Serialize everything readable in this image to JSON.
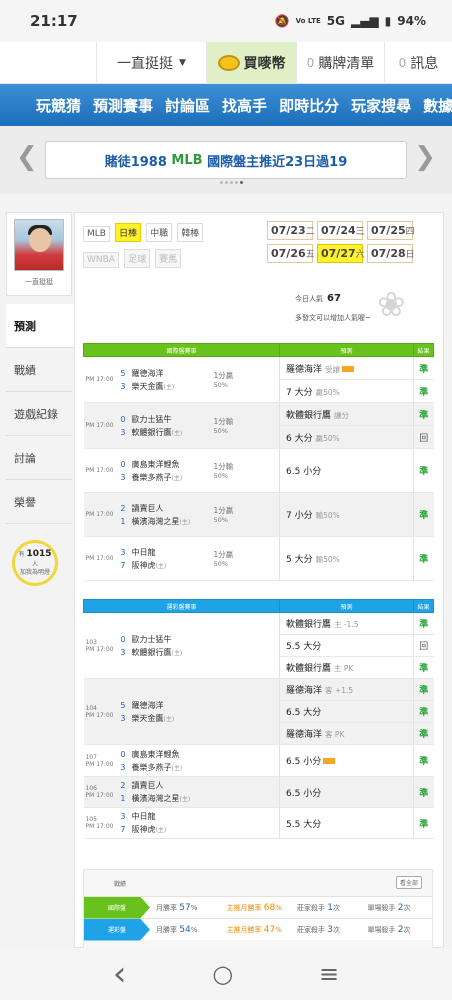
{
  "status": {
    "time": "21:17",
    "battery": "94%",
    "network": "5G",
    "volte": "VoLTE"
  },
  "topbar": {
    "dropdown": "一直挺挺",
    "coin": "買嘜幣",
    "cart": "購牌清單",
    "cart_count": "0",
    "msg": "訊息",
    "msg_count": "0"
  },
  "nav": [
    "玩競猜",
    "預測賽事",
    "討論區",
    "找高手",
    "即時比分",
    "玩家搜尋",
    "數據"
  ],
  "banner": {
    "user": "賭徒1988",
    "text": "國際盤主推近23日過19",
    "league": "MLB"
  },
  "profile": {
    "name": "一直挺挺"
  },
  "sidenav": [
    "預測",
    "戰績",
    "遊戲紀錄",
    "討論",
    "榮譽"
  ],
  "bulb": {
    "pre": "有",
    "count": "1015",
    "unit": "人",
    "post": "加我為明燈"
  },
  "leagues": [
    {
      "label": "MLB",
      "state": "normal"
    },
    {
      "label": "日棒",
      "state": "on"
    },
    {
      "label": "中職",
      "state": "normal"
    },
    {
      "label": "韓棒",
      "state": "normal"
    },
    {
      "label": "WNBA",
      "state": "dim"
    },
    {
      "label": "足球",
      "state": "dim"
    },
    {
      "label": "賽馬",
      "state": "dim"
    }
  ],
  "dates": [
    {
      "d": "07/23",
      "w": "二"
    },
    {
      "d": "07/24",
      "w": "三"
    },
    {
      "d": "07/25",
      "w": "四"
    },
    {
      "d": "07/26",
      "w": "五"
    },
    {
      "d": "07/27",
      "w": "六",
      "on": true
    },
    {
      "d": "07/28",
      "w": "日"
    }
  ],
  "today": {
    "label": "今日人氣",
    "value": "67"
  },
  "hint": "多發文可以增加人氣喔~",
  "intl": {
    "headers": [
      "國際盤賽事",
      "預測",
      "結果"
    ],
    "games": [
      {
        "time": "PM 17:00",
        "away_n": "5",
        "away": "羅德海洋",
        "home_n": "3",
        "home": "樂天金鷹",
        "home_tag": "(主)",
        "handicap": "1分贏",
        "hpct": "50%",
        "p1": "羅德海洋",
        "p1s": "受讓",
        "p1tag": true,
        "r1": "準",
        "p2": "7 大分",
        "p2s": "贏50%",
        "r2": "準"
      },
      {
        "time": "PM 17:00",
        "away_n": "0",
        "away": "歐力士猛牛",
        "home_n": "3",
        "home": "軟體銀行鷹",
        "home_tag": "(主)",
        "handicap": "1分輸",
        "hpct": "50%",
        "p1": "軟體銀行鷹",
        "p1s": "讓分",
        "r1": "準",
        "p2": "6 大分",
        "p2s": "贏50%",
        "r2": "回"
      },
      {
        "time": "PM 17:00",
        "away_n": "0",
        "away": "廣島東洋鯉魚",
        "home_n": "3",
        "home": "養樂多燕子",
        "home_tag": "(主)",
        "handicap": "1分輸",
        "hpct": "50%",
        "p1": "6.5 小分",
        "p1s": "",
        "r1": "準"
      },
      {
        "time": "PM 17:00",
        "away_n": "2",
        "away": "讀賣巨人",
        "home_n": "1",
        "home": "橫濱海灣之星",
        "home_tag": "(主)",
        "handicap": "1分贏",
        "hpct": "50%",
        "p1": "7 小分",
        "p1s": "輸50%",
        "r1": "準"
      },
      {
        "time": "PM 17:00",
        "away_n": "3",
        "away": "中日龍",
        "home_n": "7",
        "home": "阪神虎",
        "home_tag": "(主)",
        "handicap": "1分贏",
        "hpct": "50%",
        "p1": "5 大分",
        "p1s": "輸50%",
        "r1": "準"
      }
    ]
  },
  "lottery": {
    "headers": [
      "運彩盤賽事",
      "預測",
      "結果"
    ],
    "games": [
      {
        "no": "103",
        "time": "PM 17:00",
        "away_n": "0",
        "away": "歐力士猛牛",
        "home_n": "3",
        "home": "軟體銀行鷹",
        "home_tag": "(主)",
        "preds": [
          {
            "p": "軟體銀行鷹",
            "s": "主 -1.5",
            "r": "準"
          },
          {
            "p": "5.5 大分",
            "s": "",
            "r": "回"
          },
          {
            "p": "軟體銀行鷹",
            "s": "主 PK",
            "r": "準"
          }
        ]
      },
      {
        "no": "104",
        "time": "PM 17:00",
        "away_n": "5",
        "away": "羅德海洋",
        "home_n": "3",
        "home": "樂天金鷹",
        "home_tag": "(主)",
        "preds": [
          {
            "p": "羅德海洋",
            "s": "客 +1.5",
            "r": "準"
          },
          {
            "p": "6.5 大分",
            "s": "",
            "r": "準"
          },
          {
            "p": "羅德海洋",
            "s": "客 PK",
            "r": "準"
          }
        ]
      },
      {
        "no": "107",
        "time": "PM 17:00",
        "away_n": "0",
        "away": "廣島東洋鯉魚",
        "home_n": "3",
        "home": "養樂多燕子",
        "home_tag": "(主)",
        "preds": [
          {
            "p": "6.5 小分",
            "s": "",
            "tag": true,
            "r": "準"
          }
        ]
      },
      {
        "no": "106",
        "time": "PM 17:00",
        "away_n": "2",
        "away": "讀賣巨人",
        "home_n": "1",
        "home": "橫濱海灣之星",
        "home_tag": "(主)",
        "preds": [
          {
            "p": "6.5 小分",
            "s": "",
            "r": "準"
          }
        ]
      },
      {
        "no": "105",
        "time": "PM 17:00",
        "away_n": "3",
        "away": "中日龍",
        "home_n": "7",
        "home": "阪神虎",
        "home_tag": "(主)",
        "preds": [
          {
            "p": "5.5 大分",
            "s": "",
            "r": "準"
          }
        ]
      }
    ]
  },
  "stats": {
    "title": "戰績",
    "all": "看全部",
    "rows": [
      {
        "label": "國際盤",
        "color": "#69c21b",
        "month": "月勝率",
        "mv": "57",
        "pct": "%",
        "main": "主推月勝率",
        "mainv": "68",
        "streak": "莊家殺手",
        "sv": "1",
        "sunit": "次",
        "single": "單場殺手",
        "singlev": "2",
        "singleu": "次"
      },
      {
        "label": "運彩盤",
        "color": "#1fa3e6",
        "month": "月勝率",
        "mv": "54",
        "pct": "%",
        "main": "主推月勝率",
        "mainv": "47",
        "streak": "莊家殺手",
        "sv": "3",
        "sunit": "次",
        "single": "單場殺手",
        "singlev": "2",
        "singleu": "次"
      }
    ]
  },
  "sysnav": {
    "back": "‹",
    "home": "○",
    "menu": "≡"
  }
}
